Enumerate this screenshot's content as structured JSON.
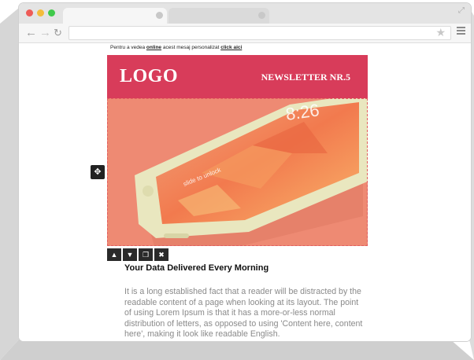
{
  "window": {
    "tabs": [
      {
        "label": "",
        "active": true
      },
      {
        "label": "",
        "active": false
      }
    ],
    "url": "",
    "traffic_lights": {
      "close": "#ee5b57",
      "minimize": "#f3bc3b",
      "maximize": "#3fc94a"
    }
  },
  "email": {
    "preheader": {
      "text_before": "Pentru a vedea ",
      "link1": "online",
      "text_middle": " acest mesaj personalizat ",
      "link2": "click aici"
    },
    "header": {
      "logo": "LOGO",
      "newsletter": "NEWSLETTER NR.5",
      "bg_color": "#d83c5a"
    },
    "hero": {
      "phone_time": "8:26",
      "phone_unlock": "slide to unlock",
      "bg_color": "#ee8a73"
    },
    "block_controls": [
      "move-up",
      "move-down",
      "duplicate",
      "delete"
    ],
    "article": {
      "headline": "Your Data Delivered Every Morning",
      "body": "It is a long established fact that a reader will be distracted by the readable content of a page when looking at its layout. The point of using Lorem Ipsum is that it has a more-or-less normal distribution of letters, as opposed to using 'Content here, content here', making it look like readable English."
    }
  }
}
